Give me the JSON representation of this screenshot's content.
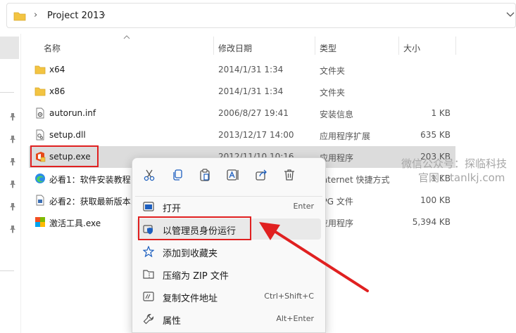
{
  "address": {
    "path": "Project 2013"
  },
  "columns": {
    "name": "名称",
    "date": "修改日期",
    "type": "类型",
    "size": "大小"
  },
  "files": [
    {
      "icon": "folder-icon",
      "name": "x64",
      "date": "2014/1/31 1:34",
      "type": "文件夹",
      "size": ""
    },
    {
      "icon": "folder-icon",
      "name": "x86",
      "date": "2014/1/31 1:34",
      "type": "文件夹",
      "size": ""
    },
    {
      "icon": "settings-file-icon",
      "name": "autorun.inf",
      "date": "2006/8/27 19:41",
      "type": "安装信息",
      "size": "1 KB"
    },
    {
      "icon": "dll-file-icon",
      "name": "setup.dll",
      "date": "2013/12/17 14:00",
      "type": "应用程序扩展",
      "size": "635 KB"
    },
    {
      "icon": "office-setup-icon",
      "name": "setup.exe",
      "date": "2012/11/10 10:16",
      "type": "应用程序",
      "size": "203 KB"
    },
    {
      "icon": "edge-shortcut-icon",
      "name": "必看1：软件安装教程",
      "date": "",
      "type": "Internet 快捷方式",
      "size": "1 KB"
    },
    {
      "icon": "image-file-icon",
      "name": "必看2：获取最新版本...",
      "date": "",
      "type": "JPG 文件",
      "size": "100 KB"
    },
    {
      "icon": "activator-exe-icon",
      "name": "激活工具.exe",
      "date": "",
      "type": "应用程序",
      "size": "5,394 KB"
    }
  ],
  "context_menu": {
    "items": [
      {
        "label": "打开",
        "shortcut": "Enter"
      },
      {
        "label": "以管理员身份运行",
        "shortcut": ""
      },
      {
        "label": "添加到收藏夹",
        "shortcut": ""
      },
      {
        "label": "压缩为 ZIP 文件",
        "shortcut": ""
      },
      {
        "label": "复制文件地址",
        "shortcut": "Ctrl+Shift+C"
      },
      {
        "label": "属性",
        "shortcut": "Alt+Enter"
      }
    ]
  },
  "watermark": {
    "line1": "微信公众号：探临科技",
    "line2": "官网：tanlkj.com"
  },
  "colors": {
    "highlight_red": "#e02020",
    "folder_yellow": "#f3c442",
    "accent_blue": "#1d5fbf"
  }
}
